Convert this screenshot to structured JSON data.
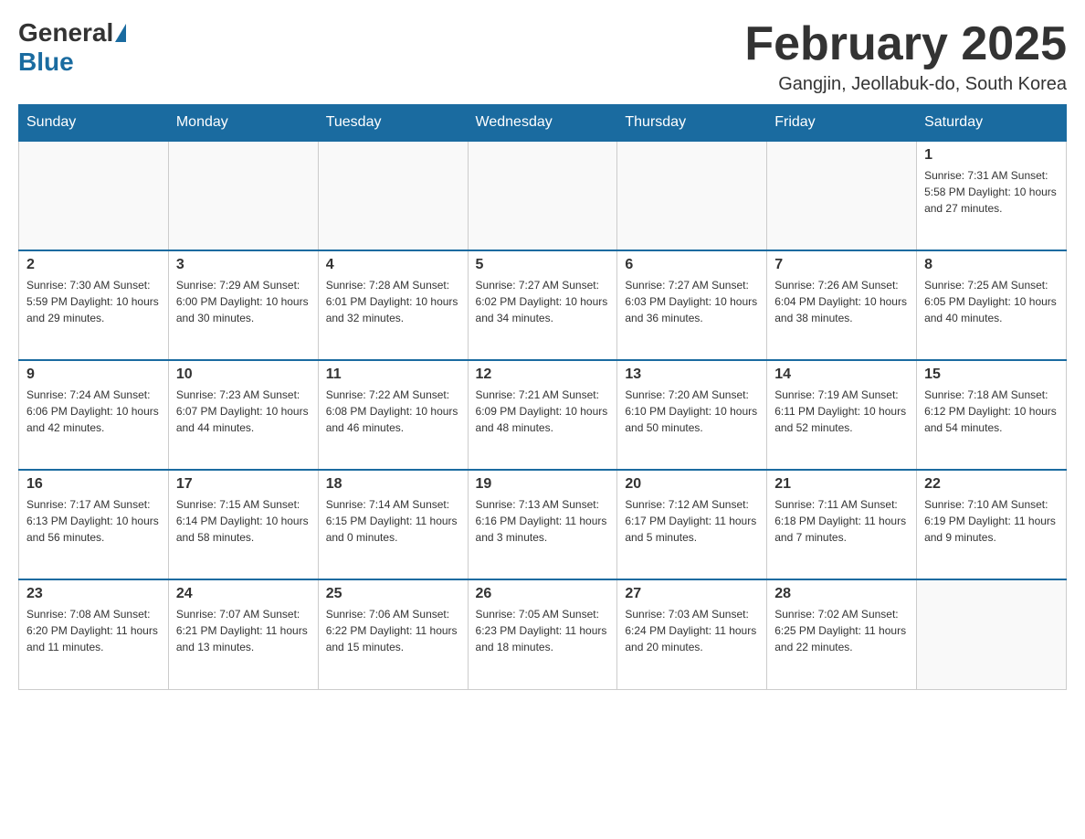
{
  "logo": {
    "general": "General",
    "blue": "Blue"
  },
  "title": "February 2025",
  "location": "Gangjin, Jeollabuk-do, South Korea",
  "days_of_week": [
    "Sunday",
    "Monday",
    "Tuesday",
    "Wednesday",
    "Thursday",
    "Friday",
    "Saturday"
  ],
  "weeks": [
    [
      {
        "day": "",
        "info": ""
      },
      {
        "day": "",
        "info": ""
      },
      {
        "day": "",
        "info": ""
      },
      {
        "day": "",
        "info": ""
      },
      {
        "day": "",
        "info": ""
      },
      {
        "day": "",
        "info": ""
      },
      {
        "day": "1",
        "info": "Sunrise: 7:31 AM\nSunset: 5:58 PM\nDaylight: 10 hours and 27 minutes."
      }
    ],
    [
      {
        "day": "2",
        "info": "Sunrise: 7:30 AM\nSunset: 5:59 PM\nDaylight: 10 hours and 29 minutes."
      },
      {
        "day": "3",
        "info": "Sunrise: 7:29 AM\nSunset: 6:00 PM\nDaylight: 10 hours and 30 minutes."
      },
      {
        "day": "4",
        "info": "Sunrise: 7:28 AM\nSunset: 6:01 PM\nDaylight: 10 hours and 32 minutes."
      },
      {
        "day": "5",
        "info": "Sunrise: 7:27 AM\nSunset: 6:02 PM\nDaylight: 10 hours and 34 minutes."
      },
      {
        "day": "6",
        "info": "Sunrise: 7:27 AM\nSunset: 6:03 PM\nDaylight: 10 hours and 36 minutes."
      },
      {
        "day": "7",
        "info": "Sunrise: 7:26 AM\nSunset: 6:04 PM\nDaylight: 10 hours and 38 minutes."
      },
      {
        "day": "8",
        "info": "Sunrise: 7:25 AM\nSunset: 6:05 PM\nDaylight: 10 hours and 40 minutes."
      }
    ],
    [
      {
        "day": "9",
        "info": "Sunrise: 7:24 AM\nSunset: 6:06 PM\nDaylight: 10 hours and 42 minutes."
      },
      {
        "day": "10",
        "info": "Sunrise: 7:23 AM\nSunset: 6:07 PM\nDaylight: 10 hours and 44 minutes."
      },
      {
        "day": "11",
        "info": "Sunrise: 7:22 AM\nSunset: 6:08 PM\nDaylight: 10 hours and 46 minutes."
      },
      {
        "day": "12",
        "info": "Sunrise: 7:21 AM\nSunset: 6:09 PM\nDaylight: 10 hours and 48 minutes."
      },
      {
        "day": "13",
        "info": "Sunrise: 7:20 AM\nSunset: 6:10 PM\nDaylight: 10 hours and 50 minutes."
      },
      {
        "day": "14",
        "info": "Sunrise: 7:19 AM\nSunset: 6:11 PM\nDaylight: 10 hours and 52 minutes."
      },
      {
        "day": "15",
        "info": "Sunrise: 7:18 AM\nSunset: 6:12 PM\nDaylight: 10 hours and 54 minutes."
      }
    ],
    [
      {
        "day": "16",
        "info": "Sunrise: 7:17 AM\nSunset: 6:13 PM\nDaylight: 10 hours and 56 minutes."
      },
      {
        "day": "17",
        "info": "Sunrise: 7:15 AM\nSunset: 6:14 PM\nDaylight: 10 hours and 58 minutes."
      },
      {
        "day": "18",
        "info": "Sunrise: 7:14 AM\nSunset: 6:15 PM\nDaylight: 11 hours and 0 minutes."
      },
      {
        "day": "19",
        "info": "Sunrise: 7:13 AM\nSunset: 6:16 PM\nDaylight: 11 hours and 3 minutes."
      },
      {
        "day": "20",
        "info": "Sunrise: 7:12 AM\nSunset: 6:17 PM\nDaylight: 11 hours and 5 minutes."
      },
      {
        "day": "21",
        "info": "Sunrise: 7:11 AM\nSunset: 6:18 PM\nDaylight: 11 hours and 7 minutes."
      },
      {
        "day": "22",
        "info": "Sunrise: 7:10 AM\nSunset: 6:19 PM\nDaylight: 11 hours and 9 minutes."
      }
    ],
    [
      {
        "day": "23",
        "info": "Sunrise: 7:08 AM\nSunset: 6:20 PM\nDaylight: 11 hours and 11 minutes."
      },
      {
        "day": "24",
        "info": "Sunrise: 7:07 AM\nSunset: 6:21 PM\nDaylight: 11 hours and 13 minutes."
      },
      {
        "day": "25",
        "info": "Sunrise: 7:06 AM\nSunset: 6:22 PM\nDaylight: 11 hours and 15 minutes."
      },
      {
        "day": "26",
        "info": "Sunrise: 7:05 AM\nSunset: 6:23 PM\nDaylight: 11 hours and 18 minutes."
      },
      {
        "day": "27",
        "info": "Sunrise: 7:03 AM\nSunset: 6:24 PM\nDaylight: 11 hours and 20 minutes."
      },
      {
        "day": "28",
        "info": "Sunrise: 7:02 AM\nSunset: 6:25 PM\nDaylight: 11 hours and 22 minutes."
      },
      {
        "day": "",
        "info": ""
      }
    ]
  ]
}
